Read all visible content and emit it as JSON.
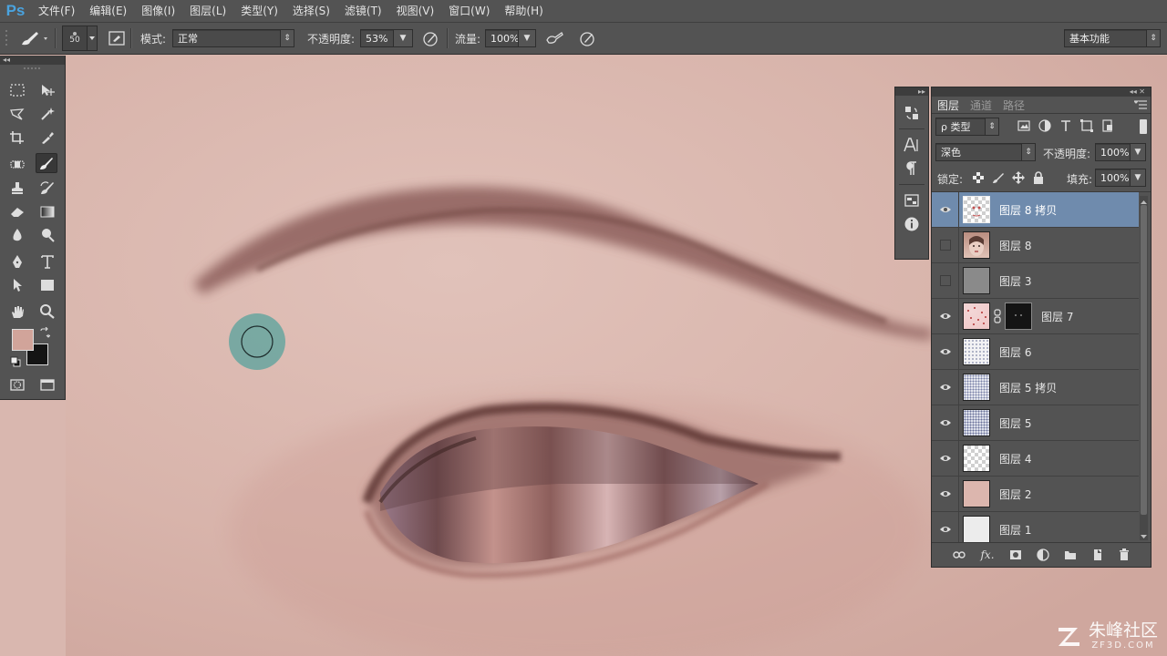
{
  "app": {
    "logo": "Ps"
  },
  "menubar": [
    "文件(F)",
    "编辑(E)",
    "图像(I)",
    "图层(L)",
    "类型(Y)",
    "选择(S)",
    "滤镜(T)",
    "视图(V)",
    "窗口(W)",
    "帮助(H)"
  ],
  "options": {
    "brush_size": "50",
    "mode_label": "模式:",
    "mode_value": "正常",
    "opacity_label": "不透明度:",
    "opacity_value": "53%",
    "flow_label": "流量:",
    "flow_value": "100%",
    "workspace": "基本功能"
  },
  "layers_panel": {
    "tabs": [
      "图层",
      "通道",
      "路径"
    ],
    "filter_label": "ρ 类型",
    "blend_mode": "深色",
    "opacity_label": "不透明度:",
    "opacity_value": "100%",
    "lock_label": "锁定:",
    "fill_label": "填充:",
    "fill_value": "100%",
    "layers": [
      {
        "name": "图层 8 拷贝",
        "visible": true,
        "selected": true
      },
      {
        "name": "图层 8",
        "visible": false,
        "selected": false
      },
      {
        "name": "图层 3",
        "visible": false,
        "selected": false
      },
      {
        "name": "图层 7",
        "visible": true,
        "selected": false,
        "has_mask": true
      },
      {
        "name": "图层 6",
        "visible": true,
        "selected": false
      },
      {
        "name": "图层 5 拷贝",
        "visible": true,
        "selected": false
      },
      {
        "name": "图层 5",
        "visible": true,
        "selected": false
      },
      {
        "name": "图层 4",
        "visible": true,
        "selected": false
      },
      {
        "name": "图层 2",
        "visible": true,
        "selected": false
      },
      {
        "name": "图层 1",
        "visible": true,
        "selected": false
      }
    ],
    "footer_icons": [
      "link-icon",
      "fx-icon",
      "mask-icon",
      "adjustment-icon",
      "group-folder-icon",
      "new-layer-icon",
      "trash-icon"
    ]
  },
  "colors": {
    "foreground": "#d1a49a",
    "background": "#141414",
    "accent": "#6f8bad",
    "ui_bg": "#535353"
  },
  "watermark": {
    "cn": "朱峰社区",
    "url": "ZF3D.COM"
  }
}
